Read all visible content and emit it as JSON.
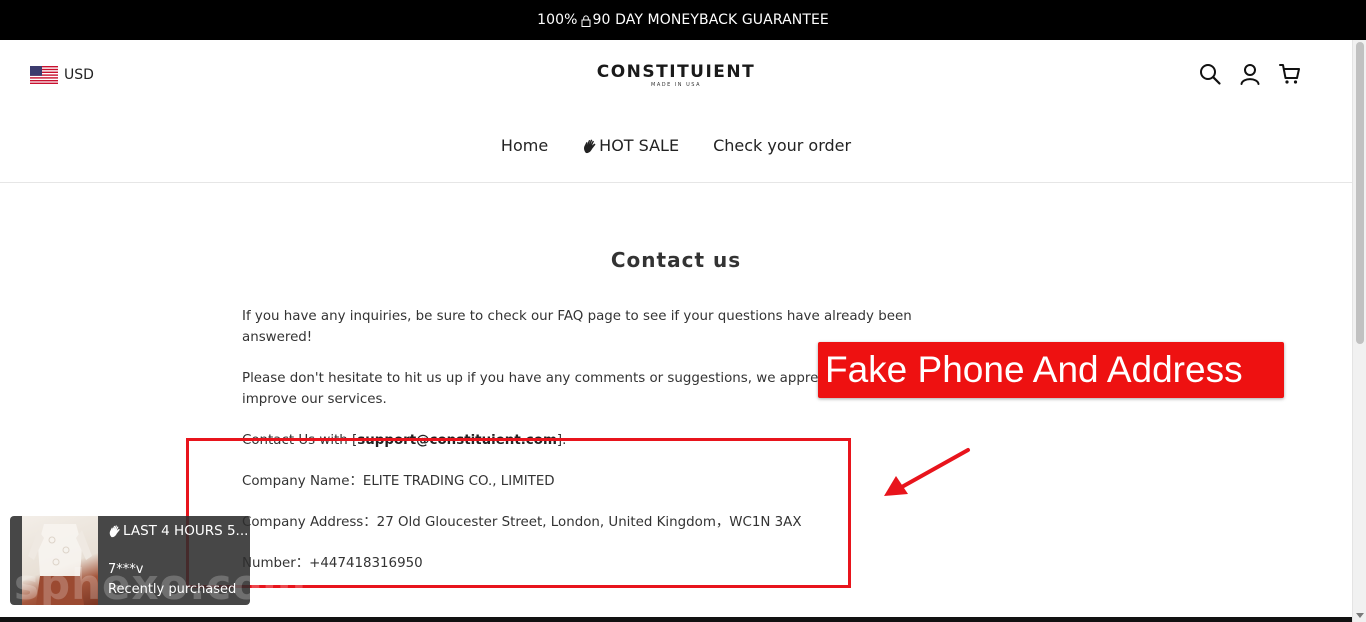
{
  "announcement": {
    "prefix": "100%",
    "suffix": "90 DAY MONEYBACK GUARANTEE"
  },
  "header": {
    "currency": "USD",
    "logo": {
      "name": "CONSTITUIENT",
      "tagline": "MADE IN USA"
    },
    "icons": [
      "search-icon",
      "account-icon",
      "cart-icon"
    ]
  },
  "nav": {
    "items": [
      {
        "label": "Home"
      },
      {
        "label": "HOT SALE"
      },
      {
        "label": "Check your order"
      }
    ]
  },
  "main": {
    "title": "Contact us",
    "para1": "If you have any inquiries, be sure to check our FAQ page to see if your questions have already been answered!",
    "para2a": "Please don't hesitate to hit us up if you have any comments or suggestions, we appreciate",
    "para2b": "improve our services.",
    "contact_prefix": "Contact Us with [",
    "contact_email": "support@constituient.com",
    "contact_suffix": "].",
    "company_name": "Company Name：ELITE TRADING CO., LIMITED",
    "company_address": "Company Address：27 Old Gloucester Street, London, United Kingdom，WC1N 3AX",
    "phone": "Number：+447418316950"
  },
  "annotation": {
    "label": "Fake Phone And Address",
    "color": "#ee1111"
  },
  "popup": {
    "title": "LAST 4 HOURS 5...",
    "user": "7***v",
    "note": "Recently purchased"
  },
  "watermark": "sphexo.com"
}
